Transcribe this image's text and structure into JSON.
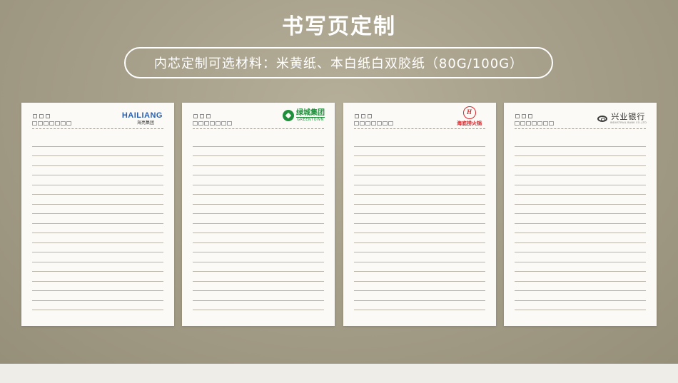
{
  "header": {
    "title": "书写页定制",
    "subtitle": "内芯定制可选材料：米黄纸、本白纸白双胶纸（80G/100G）"
  },
  "papers": [
    {
      "logo_main": "HAILIANG",
      "logo_sub": "海亮集团"
    },
    {
      "logo_main": "绿城集团",
      "logo_sub": "GREENTOWN"
    },
    {
      "logo_main": "海底捞火锅",
      "logo_mark": "H"
    },
    {
      "logo_main": "兴业银行",
      "logo_sub": "INDUSTRIAL BANK CO.,LTD"
    }
  ],
  "colors": {
    "hailiang": "#2a5fae",
    "greentown": "#1f8f3c",
    "haidilao": "#d8262c",
    "cib": "#333333"
  }
}
